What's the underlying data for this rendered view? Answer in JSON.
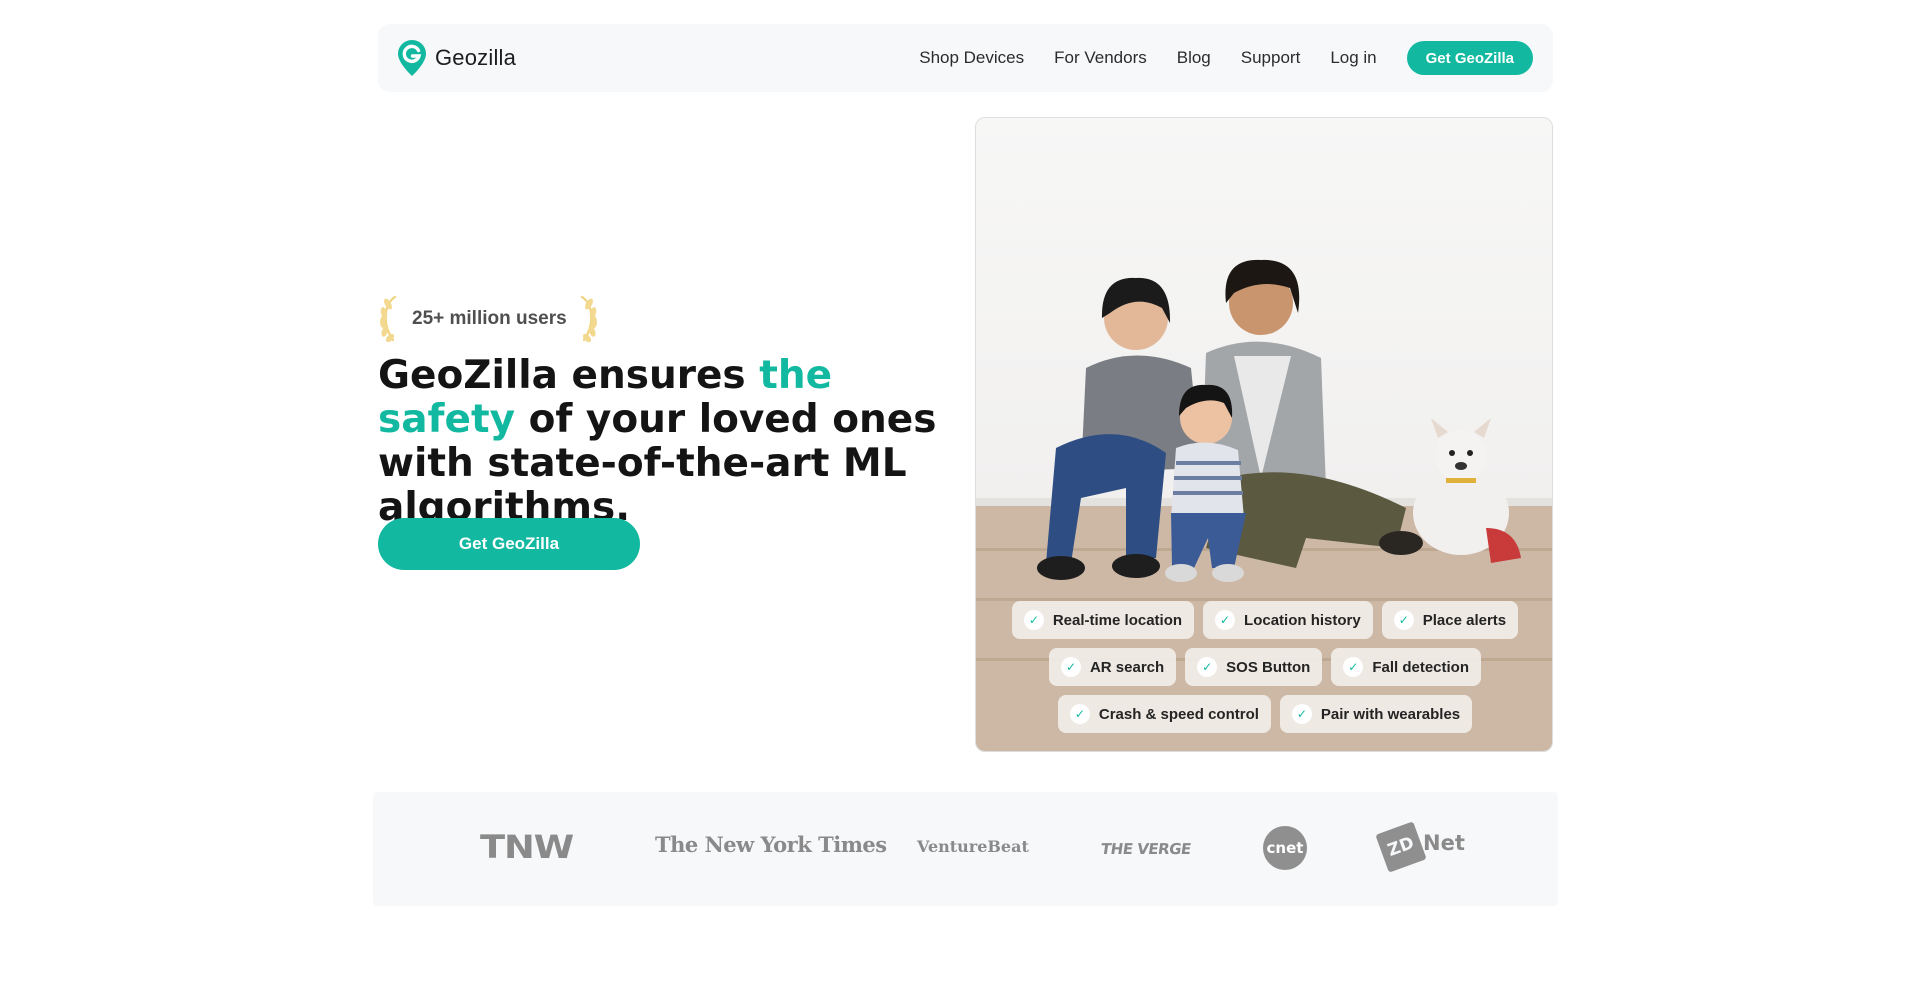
{
  "header": {
    "brand_name": "Geozilla",
    "nav": [
      {
        "label": "Shop Devices"
      },
      {
        "label": "For Vendors"
      },
      {
        "label": "Blog"
      },
      {
        "label": "Support"
      },
      {
        "label": "Log in"
      }
    ],
    "cta_label": "Get GeoZilla",
    "logo_icon": "location-pin-g-icon",
    "accent_color": "#12b9a0"
  },
  "hero": {
    "award_text": "25+ million users",
    "award_icon": "laurel-icon",
    "headline_before": "GeoZilla ensures ",
    "headline_accent": "the safety",
    "headline_after": " of your loved ones with state-of-the-art ML algorithms.",
    "cta_label": "Get GeoZilla",
    "feature_rows": [
      [
        {
          "label": "Real-time location"
        },
        {
          "label": "Location history"
        },
        {
          "label": "Place alerts"
        }
      ],
      [
        {
          "label": "AR search"
        },
        {
          "label": "SOS Button"
        },
        {
          "label": "Fall detection"
        }
      ],
      [
        {
          "label": "Crash & speed control"
        },
        {
          "label": "Pair with wearables"
        }
      ]
    ],
    "check_glyph": "✓",
    "check_icon": "check-icon"
  },
  "press": {
    "logos": [
      {
        "text": "TNW"
      },
      {
        "text": "The New York Times"
      },
      {
        "text": "VentureBeat"
      },
      {
        "text": "THE VERGE"
      },
      {
        "text": "cnet"
      },
      {
        "mark": "ZD",
        "text": "Net"
      }
    ]
  }
}
